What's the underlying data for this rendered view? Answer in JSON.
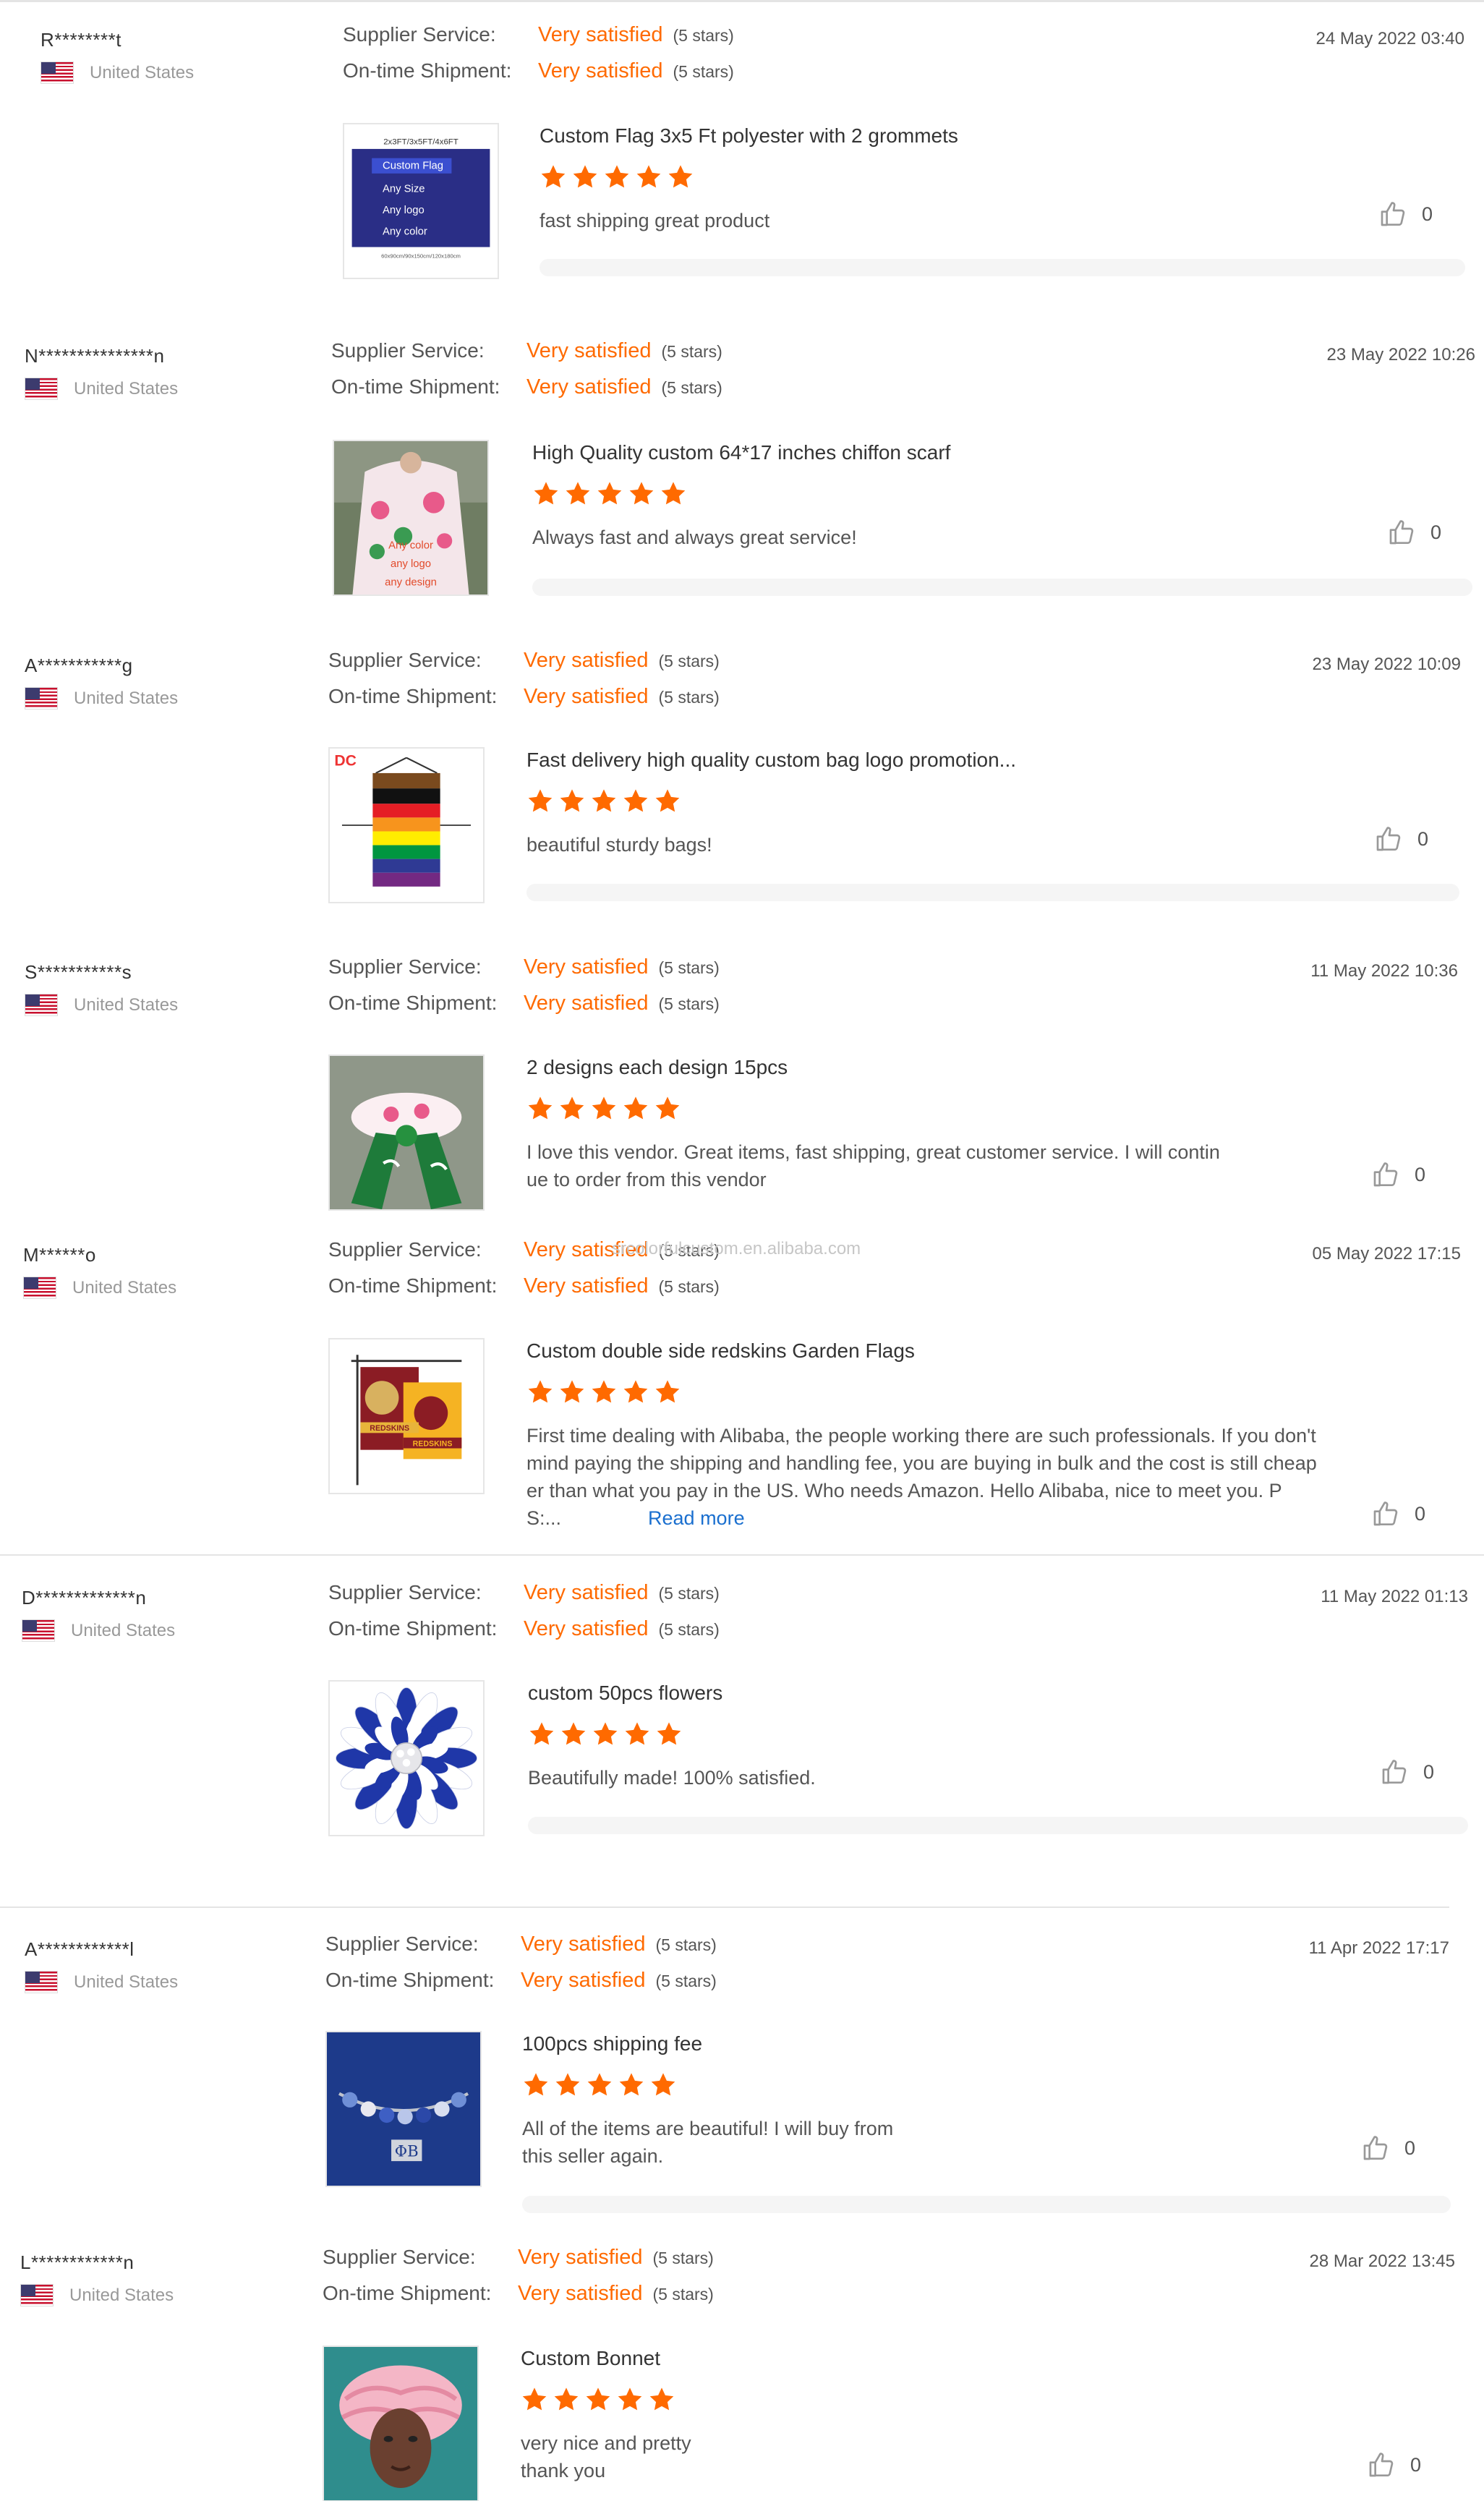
{
  "labels": {
    "supplier_service": "Supplier Service:",
    "ontime_shipment": "On-time Shipment:"
  },
  "watermark": "srcolorfulcustom.en.alibaba.com",
  "colors": {
    "accent": "#ff6a00",
    "link": "#1a6fcf",
    "text": "#333333",
    "muted": "#999999"
  },
  "icons": {
    "like": "thumbs-up-icon",
    "star": "star-icon",
    "flag": "us-flag-icon"
  },
  "reviews": [
    {
      "buyer": "R********t",
      "country": "United States",
      "supplier_service": "Very satisfied",
      "supplier_stars": "(5 stars)",
      "shipment": "Very satisfied",
      "shipment_stars": "(5 stars)",
      "date": "24 May 2022 03:40",
      "product_title": "Custom Flag 3x5 Ft polyester with 2 grommets",
      "rating": 5,
      "comment": "fast shipping great product",
      "likes": "0",
      "image": {
        "header": "2x3FT/3x5FT/4x6FT",
        "lines": [
          "Custom Flag",
          "Any Size",
          "Any logo",
          "Any color"
        ],
        "footer": "60x90cm/90x150cm/120x180cm"
      }
    },
    {
      "buyer": "N***************n",
      "country": "United States",
      "supplier_service": "Very satisfied",
      "supplier_stars": "(5 stars)",
      "shipment": "Very satisfied",
      "shipment_stars": "(5 stars)",
      "date": "23 May 2022 10:26",
      "product_title": "High Quality custom 64*17 inches chiffon scarf",
      "rating": 5,
      "comment": "Always fast and always great service!",
      "likes": "0",
      "image": {
        "lines": [
          "Any color",
          "any logo",
          "any design"
        ]
      }
    },
    {
      "buyer": "A***********g",
      "country": "United States",
      "supplier_service": "Very satisfied",
      "supplier_stars": "(5 stars)",
      "shipment": "Very satisfied",
      "shipment_stars": "(5 stars)",
      "date": "23 May 2022 10:09",
      "product_title": "Fast delivery high quality custom bag logo promotion...",
      "rating": 5,
      "comment": "beautiful sturdy bags!",
      "likes": "0",
      "image": {
        "logo": "DC"
      }
    },
    {
      "buyer": "S***********s",
      "country": "United States",
      "supplier_service": "Very satisfied",
      "supplier_stars": "(5 stars)",
      "shipment": "Very satisfied",
      "shipment_stars": "(5 stars)",
      "date": "11 May 2022 10:36",
      "product_title": "2 designs each design 15pcs",
      "rating": 5,
      "comment": "I love this vendor. Great items, fast shipping, great customer service.  I will contin\nue to order from this vendor",
      "likes": "0",
      "image": {}
    },
    {
      "buyer": "M******o",
      "country": "United States",
      "supplier_service": "Very satisfied",
      "supplier_stars": "(5 stars)",
      "shipment": "Very satisfied",
      "shipment_stars": "(5 stars)",
      "date": "05 May 2022 17:15",
      "product_title": "Custom double side redskins Garden Flags",
      "rating": 5,
      "comment": "First time dealing with Alibaba, the people working there are such professionals. If you don't\nmind paying the shipping and handling fee, you are buying in bulk and the cost is still cheap\ner than what you pay in the US. Who needs Amazon. Hello Alibaba, nice to meet you. P\nS:...",
      "read_more": "Read more",
      "likes": "0",
      "image": {
        "lines": [
          "REDSKINS",
          "REDSKINS"
        ]
      }
    },
    {
      "buyer": "D*************n",
      "country": "United States",
      "supplier_service": "Very satisfied",
      "supplier_stars": "(5 stars)",
      "shipment": "Very satisfied",
      "shipment_stars": "(5 stars)",
      "date": "11 May 2022 01:13",
      "product_title": "custom 50pcs flowers",
      "rating": 5,
      "comment": "Beautifully made!  100% satisfied.",
      "likes": "0",
      "image": {}
    },
    {
      "buyer": "A************l",
      "country": "United States",
      "supplier_service": "Very satisfied",
      "supplier_stars": "(5 stars)",
      "shipment": "Very satisfied",
      "shipment_stars": "(5 stars)",
      "date": "11 Apr 2022 17:17",
      "product_title": "100pcs shipping fee",
      "rating": 5,
      "comment": "All of the items are beautiful! I will buy from\nthis seller again.",
      "likes": "0",
      "image": {}
    },
    {
      "buyer": "L************n",
      "country": "United States",
      "supplier_service": "Very satisfied",
      "supplier_stars": "(5 stars)",
      "shipment": "Very satisfied",
      "shipment_stars": "(5 stars)",
      "date": "28 Mar 2022 13:45",
      "product_title": "Custom Bonnet",
      "rating": 5,
      "comment": "very nice and pretty\nthank you",
      "likes": "0",
      "image": {}
    }
  ]
}
